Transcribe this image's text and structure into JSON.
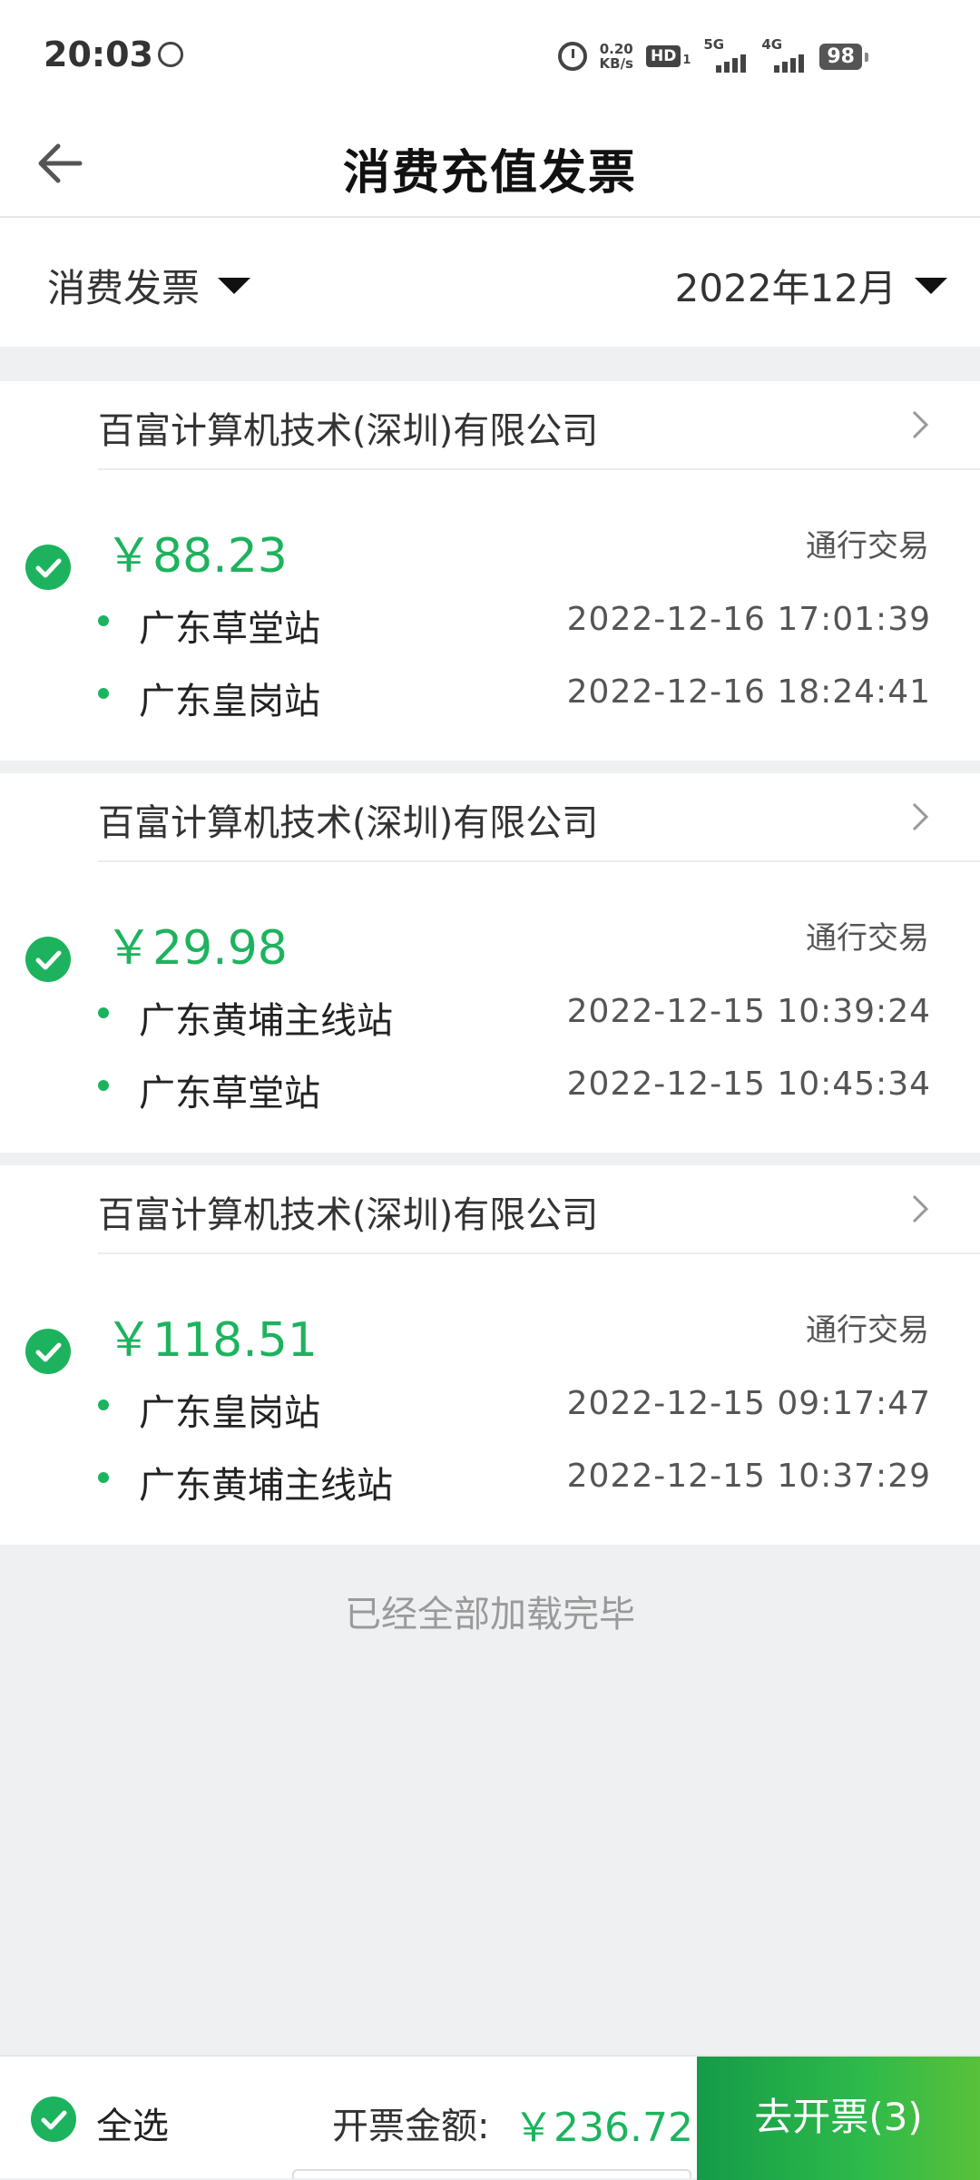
{
  "status_bar": {
    "time": "20:03",
    "circle_icon": "Ⓛ",
    "net_speed_value": "0.20",
    "net_speed_unit": "KB/s",
    "hd": "HD",
    "hd_sub": "1",
    "signal_1": "5G",
    "signal_2": "4G",
    "battery": "98"
  },
  "nav": {
    "title": "消费充值发票",
    "back_icon": "arrow-left-icon"
  },
  "filters": {
    "type_label": "消费发票",
    "month_label": "2022年12月"
  },
  "records": [
    {
      "merchant": "百富计算机技术(深圳)有限公司",
      "amount": "￥88.23",
      "type": "通行交易",
      "entries": [
        {
          "station": "广东草堂站",
          "time": "2022-12-16 17:01:39"
        },
        {
          "station": "广东皇岗站",
          "time": "2022-12-16 18:24:41"
        }
      ]
    },
    {
      "merchant": "百富计算机技术(深圳)有限公司",
      "amount": "￥29.98",
      "type": "通行交易",
      "entries": [
        {
          "station": "广东黄埔主线站",
          "time": "2022-12-15 10:39:24"
        },
        {
          "station": "广东草堂站",
          "time": "2022-12-15 10:45:34"
        }
      ]
    },
    {
      "merchant": "百富计算机技术(深圳)有限公司",
      "amount": "￥118.51",
      "type": "通行交易",
      "entries": [
        {
          "station": "广东皇岗站",
          "time": "2022-12-15 09:17:47"
        },
        {
          "station": "广东黄埔主线站",
          "time": "2022-12-15 10:37:29"
        }
      ]
    }
  ],
  "end_text": "已经全部加载完毕",
  "bottom": {
    "select_all": "全选",
    "amount_label": "开票金额:",
    "total": "￥236.72",
    "button": "去开票(3)"
  },
  "colors": {
    "accent": "#1db35e",
    "background": "#eff0f2"
  }
}
